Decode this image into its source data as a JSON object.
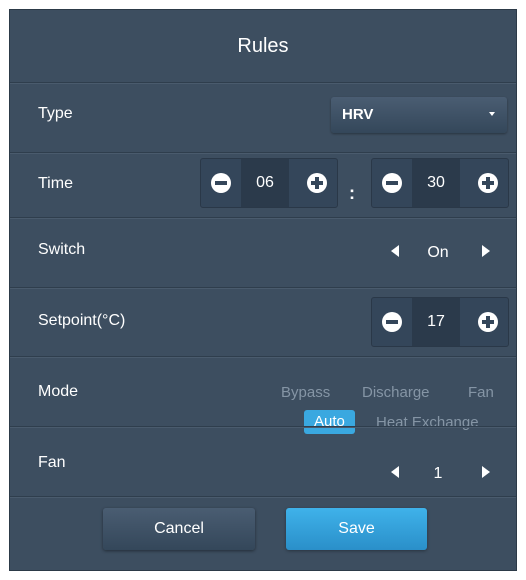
{
  "dialog": {
    "title": "Rules"
  },
  "rows": {
    "type": {
      "label": "Type",
      "value": "HRV"
    },
    "time": {
      "label": "Time",
      "hours": "06",
      "separator": ":",
      "minutes": "30"
    },
    "switch": {
      "label": "Switch",
      "value": "On"
    },
    "setpoint": {
      "label": "Setpoint(°C)",
      "value": "17"
    },
    "mode": {
      "label": "Mode",
      "options": [
        "Bypass",
        "Discharge",
        "Fan",
        "Auto",
        "Heat Exchange"
      ],
      "selected": "Auto"
    },
    "fan": {
      "label": "Fan",
      "value": "1"
    }
  },
  "footer": {
    "cancel_label": "Cancel",
    "save_label": "Save"
  },
  "colors": {
    "background": "#3d4e60",
    "accent": "#3aa8e0",
    "stepper_value_bg": "#2b3a4b",
    "inactive_option": "#8595a5"
  },
  "icons": {
    "dropdown": "caret-down-icon",
    "decrement": "minus-circle-icon",
    "increment": "plus-circle-icon",
    "previous": "triangle-left-icon",
    "next": "triangle-right-icon"
  }
}
